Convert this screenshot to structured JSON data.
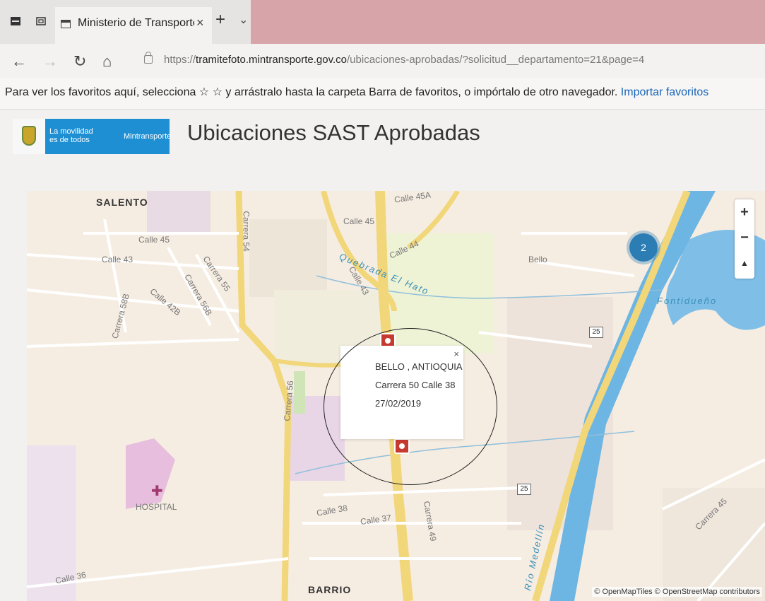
{
  "browser": {
    "tab_title": "Ministerio de Transporte",
    "tab_close": "×",
    "new_tab": "+",
    "tab_menu": "⌄",
    "back": "←",
    "forward": "→",
    "refresh": "↻",
    "home": "⌂",
    "url_scheme": "https://",
    "url_host": "tramitefoto.mintransporte.gov.co",
    "url_path": "/ubicaciones-aprobadas/?solicitud__departamento=21&page=4",
    "favorites_text": "Para ver los favoritos aquí, selecciona ☆ ☆ y arrástralo hasta la carpeta Barra de favoritos, o impórtalo de otro navegador. ",
    "favorites_link": "Importar favoritos"
  },
  "header": {
    "brand_line": "La movilidad es de todos",
    "brand_ministry": "Mintransporte",
    "title": "Ubicaciones SAST Aprobadas"
  },
  "map": {
    "zoom_in": "+",
    "zoom_out": "−",
    "north": "▲",
    "cluster_count": "2",
    "popup": {
      "close": "×",
      "city": "BELLO , ANTIOQUIA",
      "address": "Carrera 50 Calle 38",
      "date": "27/02/2019"
    },
    "labels": {
      "salento": "SALENTO",
      "barrio": "BARRIO",
      "hospital": "HOSPITAL",
      "bello": "Bello",
      "fontidueno": "Fontidueño",
      "quebrada": "Quebrada El Hato",
      "calle45a": "Calle 45A",
      "calle45": "Calle 45",
      "calle45_left": "Calle 45",
      "calle44": "Calle 44",
      "calle43": "Calle 43",
      "calle43_left": "Calle 43",
      "calle42b": "Calle 42B",
      "calle38": "Calle 38",
      "calle37": "Calle 37",
      "calle36": "Calle 36",
      "carrera54": "Carrera 54",
      "carrera55": "Carrera 55",
      "carrera56b": "Carrera 56B",
      "carrera58b": "Carrera 58B",
      "carrera56": "Carrera 56",
      "carrera49": "Carrera 49",
      "carrera45": "Carrera 45",
      "rio": "Río Medellín",
      "route25": "25"
    },
    "attribution": "© OpenMapTiles © OpenStreetMap contributors"
  }
}
